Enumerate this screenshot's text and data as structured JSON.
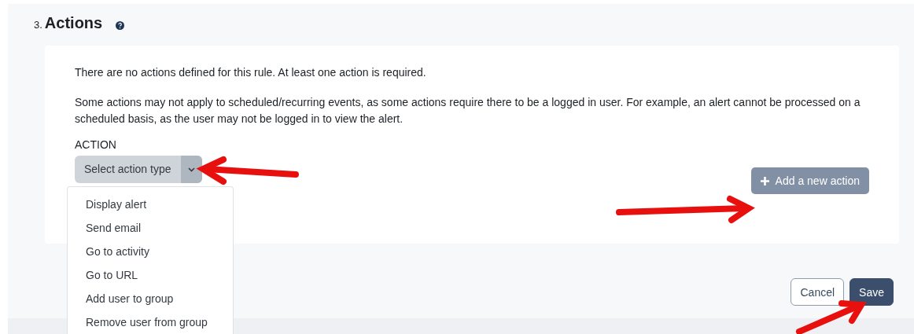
{
  "section": {
    "number": "3.",
    "title": "Actions"
  },
  "card": {
    "notice": "There are no actions defined for this rule. At least one action is required.",
    "info": "Some actions may not apply to scheduled/recurring events, as some actions require there to be a logged in user. For example, an alert cannot be processed on a scheduled basis, as the user may not be logged in to view the alert.",
    "field_label": "ACTION",
    "select": {
      "value": "Select action type",
      "expanded": true,
      "options": [
        "Display alert",
        "Send email",
        "Go to activity",
        "Go to URL",
        "Add user to group",
        "Remove user from group"
      ]
    },
    "add_button": {
      "label": "Add a new action",
      "disabled": true
    }
  },
  "buttons": [
    {
      "label": "Cancel",
      "kind": "secondary"
    },
    {
      "label": "Save",
      "kind": "primary"
    }
  ]
}
